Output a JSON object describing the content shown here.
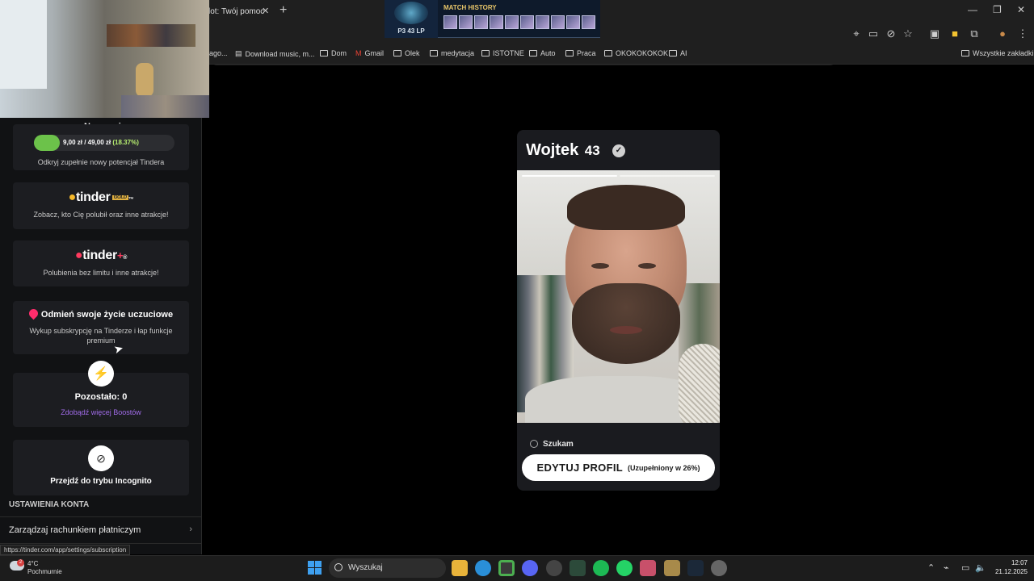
{
  "browser": {
    "tab_title": "lot: Twój pomoc",
    "bookmarks": [
      {
        "label": "ago...",
        "icon": "partial"
      },
      {
        "label": "Download music, m...",
        "icon": "page-icon"
      },
      {
        "label": "Dom",
        "icon": "folder-icon"
      },
      {
        "label": "Gmail",
        "icon": "gmail-icon"
      },
      {
        "label": "Olek",
        "icon": "folder-icon"
      },
      {
        "label": "medytacja",
        "icon": "folder-icon"
      },
      {
        "label": "ISTOTNE",
        "icon": "folder-icon"
      },
      {
        "label": "Auto",
        "icon": "folder-icon"
      },
      {
        "label": "Praca",
        "icon": "folder-icon"
      },
      {
        "label": "OKOKOKOKOK",
        "icon": "folder-icon"
      },
      {
        "label": "AI",
        "icon": "folder-icon"
      }
    ],
    "all_bookmarks": "Wszystkie zakładki",
    "status_url": "https://tinder.com/app/settings/subscription"
  },
  "overlay": {
    "title": "MATCH HISTORY",
    "rank_label": "P3 43 LP",
    "games_count": 10
  },
  "sidebar": {
    "na_pensje": {
      "title": "Na pensję",
      "watermark": "tinder",
      "progress_text": "9,00 zł / 49,00 zł",
      "progress_pct": "(18.37%)",
      "progress_value": 0.1837,
      "caption": "Odkryj zupełnie nowy potencjał Tindera"
    },
    "gold": {
      "logo": "tinder",
      "badge": "GOLD",
      "tm": "™",
      "caption": "Zobacz, kto Cię polubił oraz inne atrakcje!"
    },
    "plus": {
      "logo": "tinder",
      "plus": "+",
      "reg": "®",
      "caption": "Polubienia bez limitu i inne atrakcje!"
    },
    "premium": {
      "heading": "Odmień swoje życie uczuciowe",
      "caption": "Wykup subskrypcję na Tinderze i łap funkcje premium"
    },
    "boost": {
      "remaining": "Pozostało: 0",
      "link": "Zdobądź więcej Boostów"
    },
    "incognito": {
      "label": "Przejdź do trybu Incognito"
    },
    "account_section": "USTAWIENIA KONTA",
    "payment_item": "Zarządzaj rachunkiem płatniczym"
  },
  "profile": {
    "name": "Wojtek",
    "age": "43",
    "seeking": "Szukam",
    "edit_button": "EDYTUJ PROFIL",
    "edit_status": "(Uzupełniony w 26%)",
    "photo_count": 2,
    "active_photo": 1
  },
  "taskbar": {
    "weather_temp": "4°C",
    "weather_desc": "Pochmurnie",
    "weather_badge": "2",
    "search_placeholder": "Wyszukaj",
    "time": "12:07",
    "date": "21.12.2025"
  },
  "colors": {
    "progress_green": "#6cc24a",
    "tinder_red": "#ff3a5e",
    "gold": "#f5b82a",
    "boost_purple": "#9b3cf0"
  }
}
